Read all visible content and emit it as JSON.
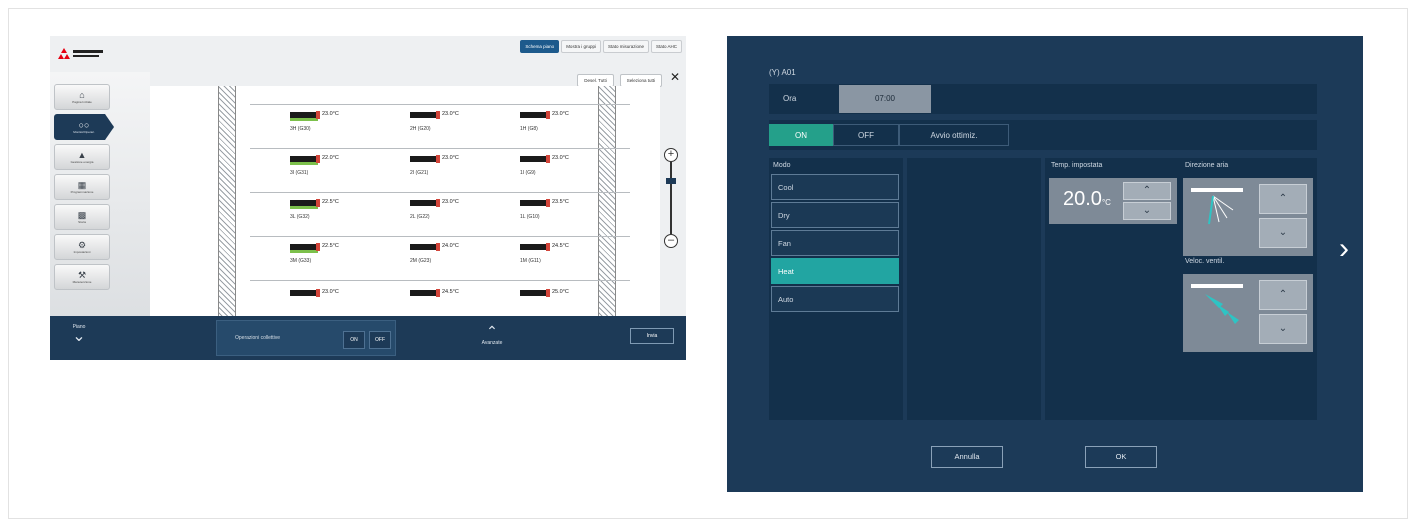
{
  "left_screen": {
    "logo": "MITSUBISHI ELECTRIC",
    "tabs": [
      "Schema piano",
      "Mostra i gruppi",
      "Stato misurazione",
      "Stato AHC"
    ],
    "top_buttons": [
      "Desel. Tutti",
      "Seleziona tutti"
    ],
    "sidebar": [
      {
        "label": "Pagina Iniziale",
        "icon": "home-icon"
      },
      {
        "label": "Monitor/Operaz.",
        "icon": "monitor-icon"
      },
      {
        "label": "Gestione energia",
        "icon": "energy-icon"
      },
      {
        "label": "Programmazione",
        "icon": "schedule-icon"
      },
      {
        "label": "Storia",
        "icon": "history-icon"
      },
      {
        "label": "Impostazioni",
        "icon": "settings-icon"
      },
      {
        "label": "Manutenzione",
        "icon": "maintenance-icon"
      }
    ],
    "units": [
      {
        "temp": "23.0°C",
        "name": "3H (G30)"
      },
      {
        "temp": "23.0°C",
        "name": "2H (G20)"
      },
      {
        "temp": "23.0°C",
        "name": "1H (G8)"
      },
      {
        "temp": "22.0°C",
        "name": "3I (G31)"
      },
      {
        "temp": "23.0°C",
        "name": "2I (G21)"
      },
      {
        "temp": "23.0°C",
        "name": "1I (G9)"
      },
      {
        "temp": "22.5°C",
        "name": "3L (G32)"
      },
      {
        "temp": "23.0°C",
        "name": "2L (G22)"
      },
      {
        "temp": "23.5°C",
        "name": "1L (G10)"
      },
      {
        "temp": "22.5°C",
        "name": "3M (G33)"
      },
      {
        "temp": "24.0°C",
        "name": "2M (G23)"
      },
      {
        "temp": "24.5°C",
        "name": "1M (G11)"
      },
      {
        "temp": "23.0°C",
        "name": ""
      },
      {
        "temp": "24.5°C",
        "name": ""
      },
      {
        "temp": "25.0°C",
        "name": ""
      }
    ],
    "bottom": {
      "floor_label": "Piano",
      "collective_label": "Operazioni collettive",
      "on": "ON",
      "off": "OFF",
      "advanced": "Avanzate",
      "send": "Invia"
    }
  },
  "right_screen": {
    "title": "(Y) A01",
    "time_label": "Ora",
    "time_value": "07:00",
    "on": "ON",
    "off": "OFF",
    "optimized_start": "Avvio ottimiz.",
    "mode_title": "Modo",
    "modes": [
      "Cool",
      "Dry",
      "Fan",
      "Heat",
      "Auto"
    ],
    "selected_mode": "Heat",
    "temp_title": "Temp. impostata",
    "temp_value": "20.0",
    "temp_unit": "°C",
    "air_direction_title": "Direzione aria",
    "fan_speed_title": "Veloc. ventil.",
    "cancel": "Annulla",
    "ok": "OK"
  },
  "colors": {
    "dark_navy": "#1c3a58",
    "panel": "#13304b",
    "teal": "#22a5a2",
    "green": "#24a08a"
  }
}
